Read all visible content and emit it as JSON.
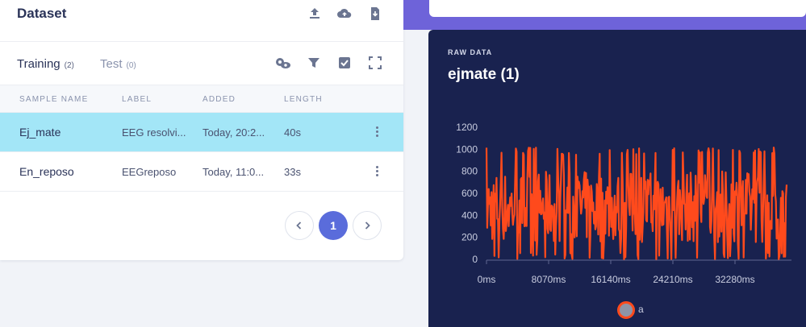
{
  "dataset": {
    "title": "Dataset",
    "header_icons": [
      "upload-icon",
      "cloud-upload-icon",
      "download-file-icon"
    ]
  },
  "tabs": [
    {
      "label": "Training",
      "count": "(2)"
    },
    {
      "label": "Test",
      "count": "(0)"
    }
  ],
  "tools": [
    "settings-view-icon",
    "filter-icon",
    "checkbox-icon",
    "expand-icon"
  ],
  "table": {
    "columns": [
      "SAMPLE NAME",
      "LABEL",
      "ADDED",
      "LENGTH"
    ],
    "rows": [
      {
        "name": "Ej_mate",
        "label": "EEG resolvi...",
        "added": "Today, 20:2...",
        "length": "40s",
        "selected": true
      },
      {
        "name": "En_reposo",
        "label": "EEGreposo",
        "added": "Today, 11:0...",
        "length": "33s",
        "selected": false
      }
    ]
  },
  "pagination": {
    "current": "1"
  },
  "raw": {
    "label": "RAW DATA",
    "title": "ejmate (1)"
  },
  "chart_data": {
    "type": "line",
    "y_ticks": [
      "1200",
      "1000",
      "800",
      "600",
      "400",
      "200",
      "0"
    ],
    "x_ticks": [
      "0ms",
      "8070ms",
      "16140ms",
      "24210ms",
      "32280ms"
    ],
    "ylim": [
      0,
      1200
    ],
    "xlim": [
      0,
      40000
    ],
    "series": [
      {
        "name": "a",
        "color": "#ff4a1c"
      }
    ]
  },
  "colors": {
    "accent": "#5a6cdb",
    "selected_row": "#a3e6f7",
    "panel": "#19224f",
    "series": "#ff4a1c"
  }
}
